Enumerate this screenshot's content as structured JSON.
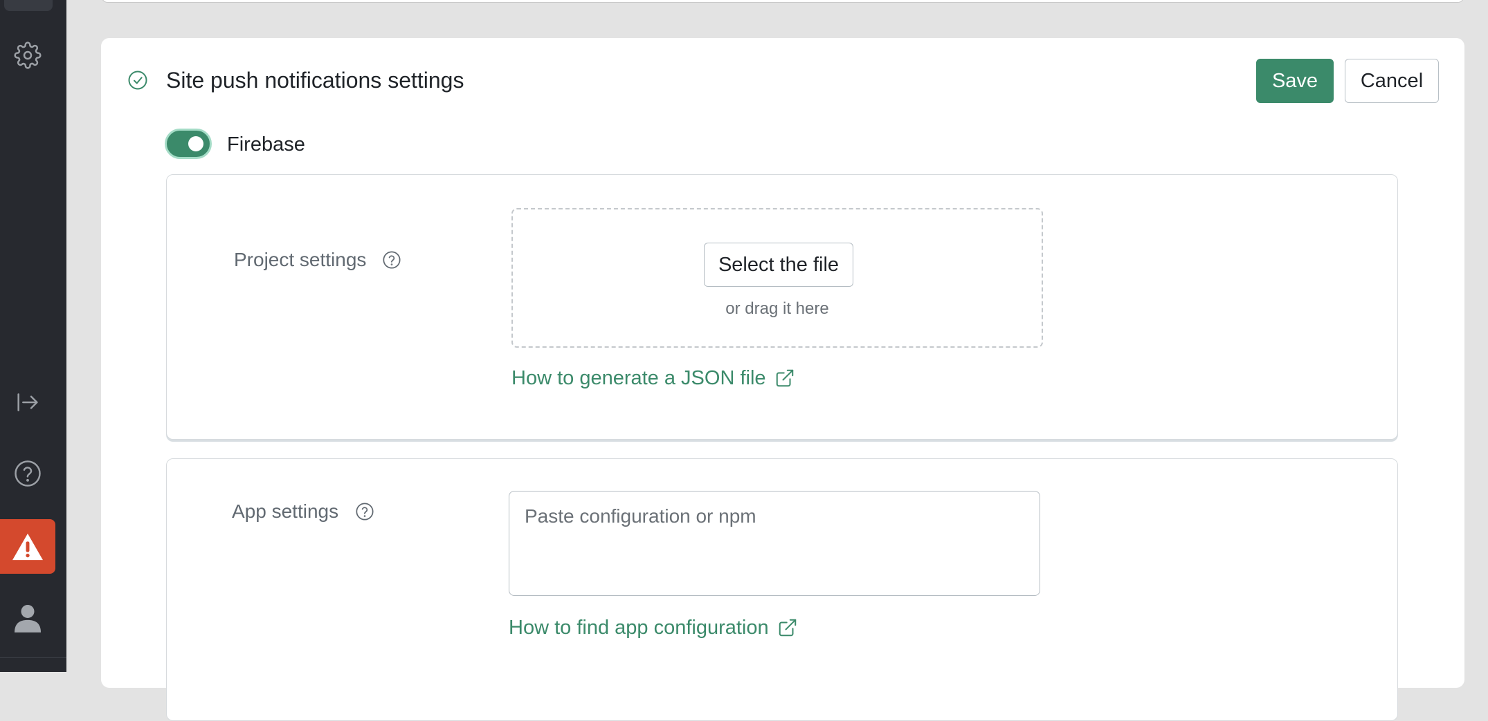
{
  "icons": {
    "settings": "gear-icon",
    "collapse": "arrow-right-to-bar-icon",
    "help": "question-circle-icon",
    "alert": "warning-triangle-icon",
    "user": "user-icon",
    "section_status": "check-circle-icon",
    "external": "external-link-icon"
  },
  "colors": {
    "sidebar_bg": "#27292f",
    "accent": "#3b8a6a",
    "alert": "#d4492d",
    "page_bg": "#e3e3e3"
  },
  "card": {
    "title": "Site push notifications settings",
    "save_label": "Save",
    "cancel_label": "Cancel"
  },
  "firebase": {
    "toggle_label": "Firebase",
    "enabled": true
  },
  "project_settings": {
    "label": "Project settings",
    "select_file_label": "Select the file",
    "drag_hint": "or drag it here",
    "link_label": "How to generate a JSON file"
  },
  "app_settings": {
    "label": "App settings",
    "placeholder": "Paste configuration or npm",
    "value": "",
    "link_label": "How to find app configuration"
  }
}
